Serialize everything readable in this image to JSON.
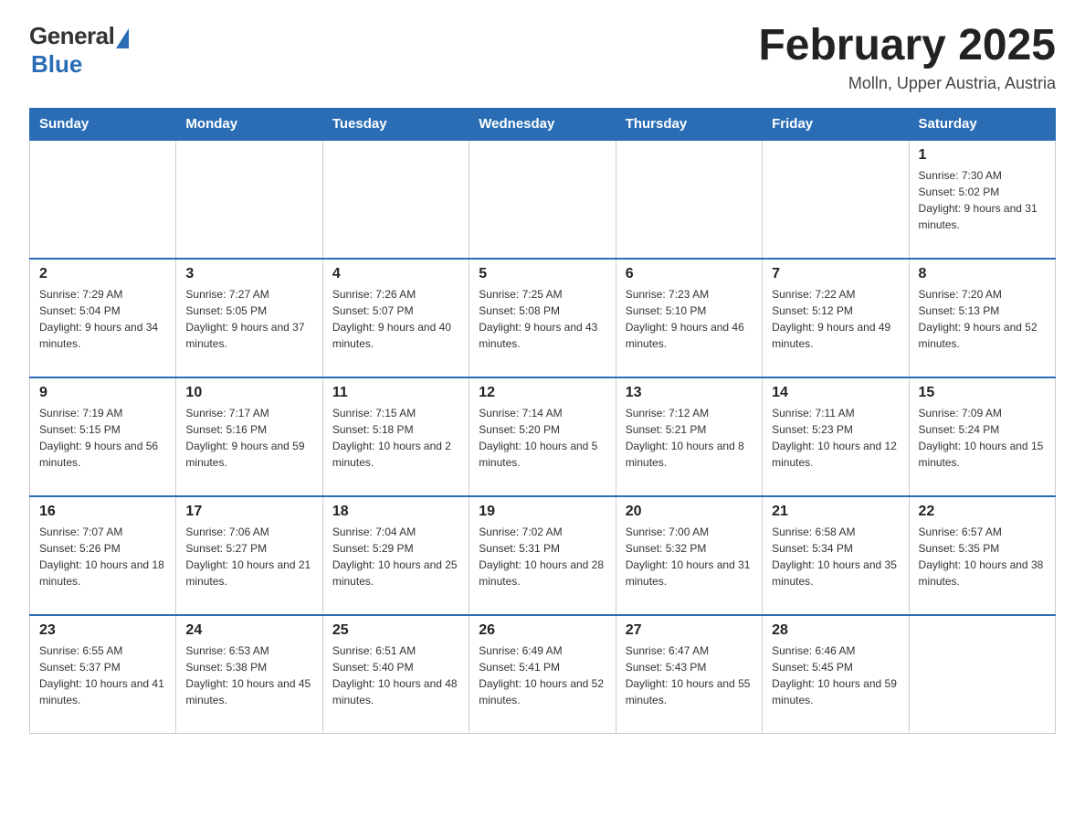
{
  "header": {
    "logo_general": "General",
    "logo_blue": "Blue",
    "month_title": "February 2025",
    "location": "Molln, Upper Austria, Austria"
  },
  "weekdays": [
    "Sunday",
    "Monday",
    "Tuesday",
    "Wednesday",
    "Thursday",
    "Friday",
    "Saturday"
  ],
  "weeks": [
    [
      {
        "day": "",
        "info": ""
      },
      {
        "day": "",
        "info": ""
      },
      {
        "day": "",
        "info": ""
      },
      {
        "day": "",
        "info": ""
      },
      {
        "day": "",
        "info": ""
      },
      {
        "day": "",
        "info": ""
      },
      {
        "day": "1",
        "info": "Sunrise: 7:30 AM\nSunset: 5:02 PM\nDaylight: 9 hours and 31 minutes."
      }
    ],
    [
      {
        "day": "2",
        "info": "Sunrise: 7:29 AM\nSunset: 5:04 PM\nDaylight: 9 hours and 34 minutes."
      },
      {
        "day": "3",
        "info": "Sunrise: 7:27 AM\nSunset: 5:05 PM\nDaylight: 9 hours and 37 minutes."
      },
      {
        "day": "4",
        "info": "Sunrise: 7:26 AM\nSunset: 5:07 PM\nDaylight: 9 hours and 40 minutes."
      },
      {
        "day": "5",
        "info": "Sunrise: 7:25 AM\nSunset: 5:08 PM\nDaylight: 9 hours and 43 minutes."
      },
      {
        "day": "6",
        "info": "Sunrise: 7:23 AM\nSunset: 5:10 PM\nDaylight: 9 hours and 46 minutes."
      },
      {
        "day": "7",
        "info": "Sunrise: 7:22 AM\nSunset: 5:12 PM\nDaylight: 9 hours and 49 minutes."
      },
      {
        "day": "8",
        "info": "Sunrise: 7:20 AM\nSunset: 5:13 PM\nDaylight: 9 hours and 52 minutes."
      }
    ],
    [
      {
        "day": "9",
        "info": "Sunrise: 7:19 AM\nSunset: 5:15 PM\nDaylight: 9 hours and 56 minutes."
      },
      {
        "day": "10",
        "info": "Sunrise: 7:17 AM\nSunset: 5:16 PM\nDaylight: 9 hours and 59 minutes."
      },
      {
        "day": "11",
        "info": "Sunrise: 7:15 AM\nSunset: 5:18 PM\nDaylight: 10 hours and 2 minutes."
      },
      {
        "day": "12",
        "info": "Sunrise: 7:14 AM\nSunset: 5:20 PM\nDaylight: 10 hours and 5 minutes."
      },
      {
        "day": "13",
        "info": "Sunrise: 7:12 AM\nSunset: 5:21 PM\nDaylight: 10 hours and 8 minutes."
      },
      {
        "day": "14",
        "info": "Sunrise: 7:11 AM\nSunset: 5:23 PM\nDaylight: 10 hours and 12 minutes."
      },
      {
        "day": "15",
        "info": "Sunrise: 7:09 AM\nSunset: 5:24 PM\nDaylight: 10 hours and 15 minutes."
      }
    ],
    [
      {
        "day": "16",
        "info": "Sunrise: 7:07 AM\nSunset: 5:26 PM\nDaylight: 10 hours and 18 minutes."
      },
      {
        "day": "17",
        "info": "Sunrise: 7:06 AM\nSunset: 5:27 PM\nDaylight: 10 hours and 21 minutes."
      },
      {
        "day": "18",
        "info": "Sunrise: 7:04 AM\nSunset: 5:29 PM\nDaylight: 10 hours and 25 minutes."
      },
      {
        "day": "19",
        "info": "Sunrise: 7:02 AM\nSunset: 5:31 PM\nDaylight: 10 hours and 28 minutes."
      },
      {
        "day": "20",
        "info": "Sunrise: 7:00 AM\nSunset: 5:32 PM\nDaylight: 10 hours and 31 minutes."
      },
      {
        "day": "21",
        "info": "Sunrise: 6:58 AM\nSunset: 5:34 PM\nDaylight: 10 hours and 35 minutes."
      },
      {
        "day": "22",
        "info": "Sunrise: 6:57 AM\nSunset: 5:35 PM\nDaylight: 10 hours and 38 minutes."
      }
    ],
    [
      {
        "day": "23",
        "info": "Sunrise: 6:55 AM\nSunset: 5:37 PM\nDaylight: 10 hours and 41 minutes."
      },
      {
        "day": "24",
        "info": "Sunrise: 6:53 AM\nSunset: 5:38 PM\nDaylight: 10 hours and 45 minutes."
      },
      {
        "day": "25",
        "info": "Sunrise: 6:51 AM\nSunset: 5:40 PM\nDaylight: 10 hours and 48 minutes."
      },
      {
        "day": "26",
        "info": "Sunrise: 6:49 AM\nSunset: 5:41 PM\nDaylight: 10 hours and 52 minutes."
      },
      {
        "day": "27",
        "info": "Sunrise: 6:47 AM\nSunset: 5:43 PM\nDaylight: 10 hours and 55 minutes."
      },
      {
        "day": "28",
        "info": "Sunrise: 6:46 AM\nSunset: 5:45 PM\nDaylight: 10 hours and 59 minutes."
      },
      {
        "day": "",
        "info": ""
      }
    ]
  ]
}
